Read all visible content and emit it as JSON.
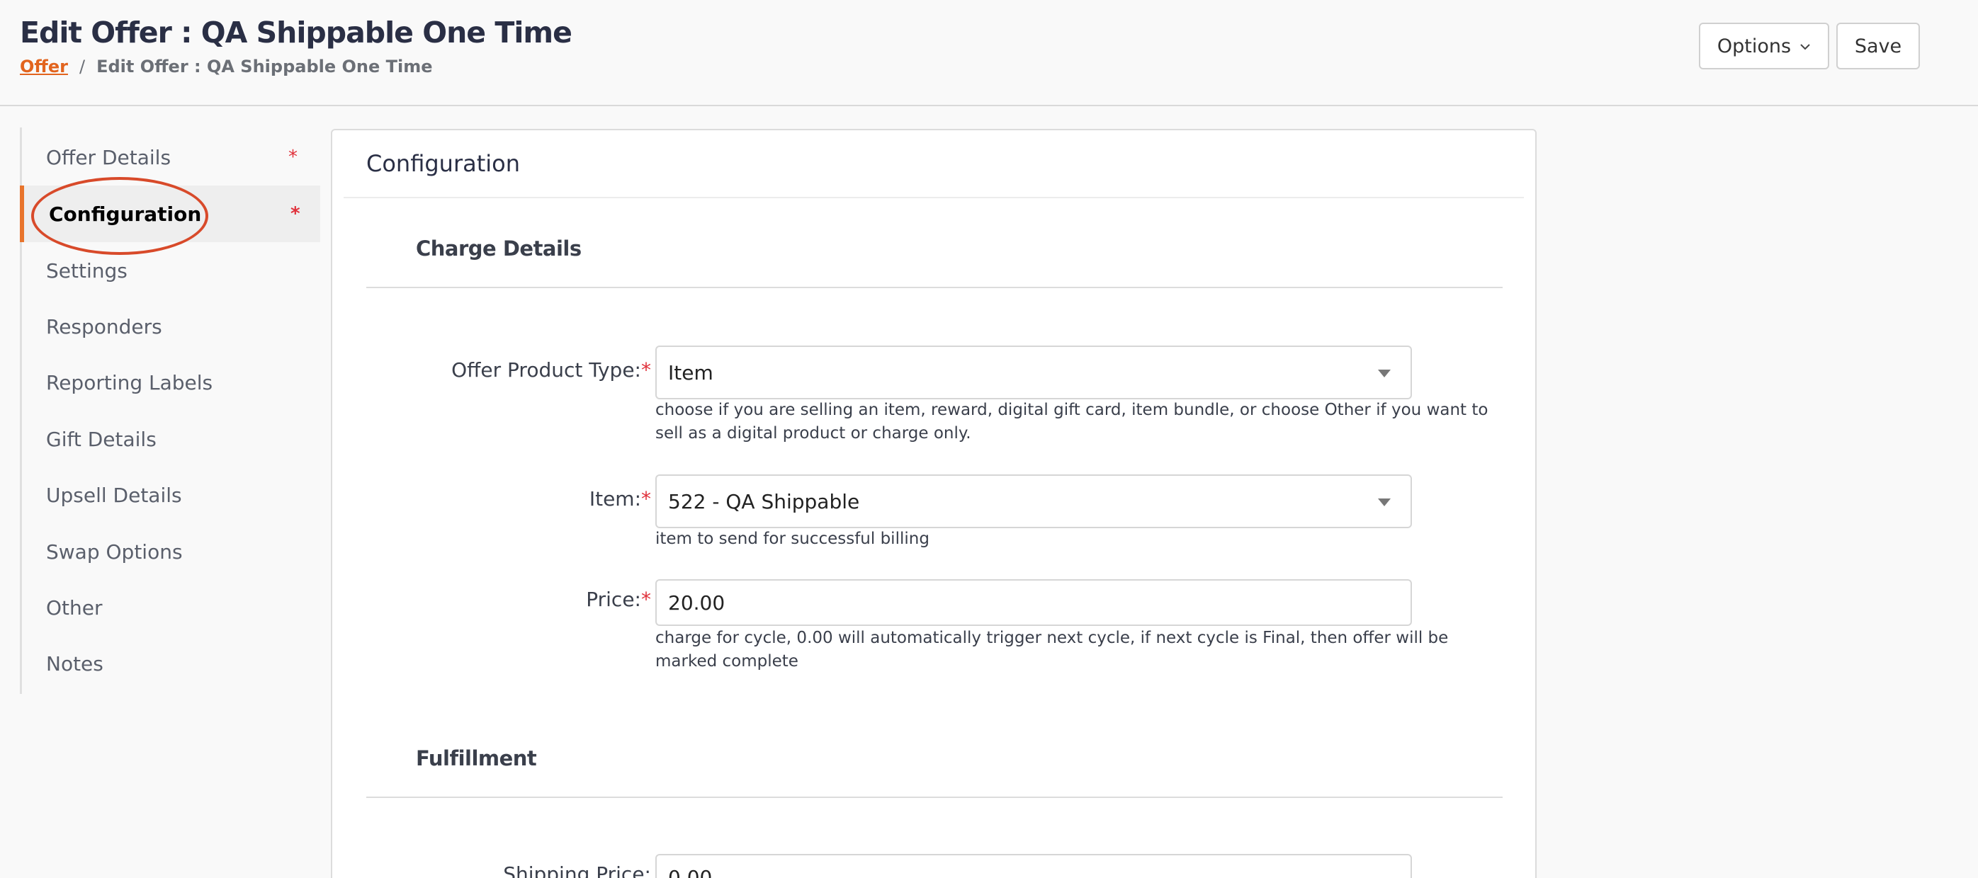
{
  "header": {
    "title": "Edit Offer : QA Shippable One Time",
    "breadcrumb": {
      "link": "Offer",
      "separator": "/",
      "current": "Edit Offer : QA Shippable One Time"
    },
    "options_label": "Options",
    "save_label": "Save"
  },
  "sidebar": {
    "items": [
      {
        "label": "Offer Details",
        "required": "*"
      },
      {
        "label": "Configuration",
        "required": "*"
      },
      {
        "label": "Settings"
      },
      {
        "label": "Responders"
      },
      {
        "label": "Reporting Labels"
      },
      {
        "label": "Gift Details"
      },
      {
        "label": "Upsell Details"
      },
      {
        "label": "Swap Options"
      },
      {
        "label": "Other"
      },
      {
        "label": "Notes"
      }
    ],
    "active_index": 1
  },
  "panel": {
    "title": "Configuration",
    "charge_details": {
      "title": "Charge Details",
      "product_type": {
        "label": "Offer Product Type:",
        "required": "*",
        "value": "Item",
        "help": "choose if you are selling an item, reward, digital gift card, item bundle, or choose Other if you want to sell as a digital product or charge only."
      },
      "item": {
        "label": "Item:",
        "required": "*",
        "value": "522 - QA Shippable",
        "help": "item to send for successful billing"
      },
      "price": {
        "label": "Price:",
        "required": "*",
        "value": "20.00",
        "help": "charge for cycle, 0.00 will automatically trigger next cycle, if next cycle is Final, then offer will be marked complete"
      }
    },
    "fulfillment": {
      "title": "Fulfillment",
      "shipping_price": {
        "label": "Shipping Price:",
        "value": "0.00"
      }
    }
  },
  "colors": {
    "accent": "#e8742c",
    "required": "#e0313b",
    "highlight": "#d84a2a"
  }
}
